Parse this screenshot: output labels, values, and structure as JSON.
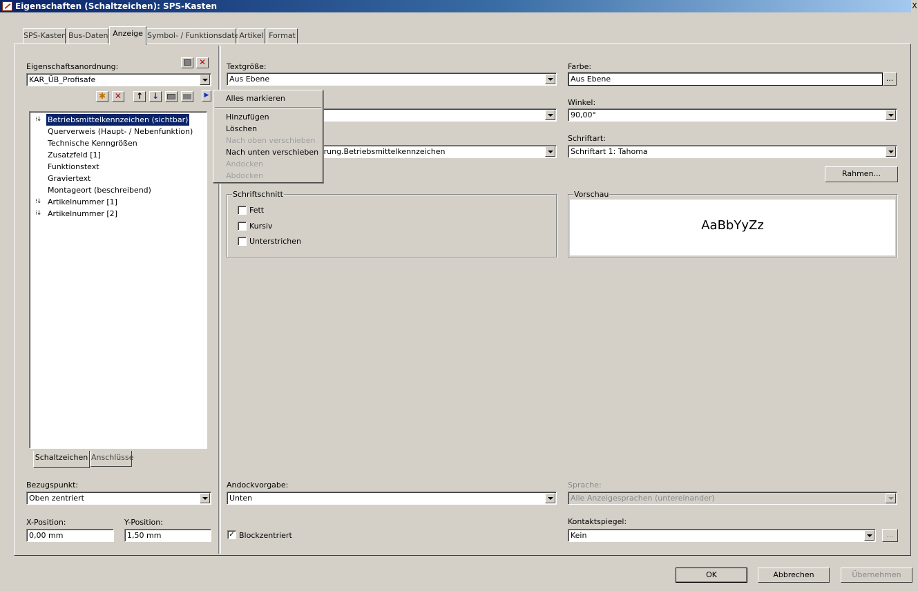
{
  "window": {
    "title": "Eigenschaften (Schaltzeichen): SPS-Kasten",
    "close_glyph": "X"
  },
  "tabs": [
    "SPS-Kasten",
    "Bus-Daten",
    "Anzeige",
    "Symbol- / Funktionsdaten",
    "Artikel",
    "Format"
  ],
  "active_tab": "Anzeige",
  "left": {
    "arrangement_label": "Eigenschaftsanordnung:",
    "arrangement_value": "KAR_ÜB_Profisafe",
    "list_items": [
      {
        "label": "Betriebsmittelkennzeichen (sichtbar)",
        "selected": true,
        "sort_icon": true
      },
      {
        "label": "Querverweis (Haupt- / Nebenfunktion)",
        "selected": false,
        "sort_icon": false
      },
      {
        "label": "Technische Kenngrößen",
        "selected": false,
        "sort_icon": false
      },
      {
        "label": "Zusatzfeld [1]",
        "selected": false,
        "sort_icon": false
      },
      {
        "label": "Funktionstext",
        "selected": false,
        "sort_icon": false
      },
      {
        "label": "Graviertext",
        "selected": false,
        "sort_icon": false
      },
      {
        "label": "Montageort (beschreibend)",
        "selected": false,
        "sort_icon": false
      },
      {
        "label": "Artikelnummer [1]",
        "selected": false,
        "sort_icon": true
      },
      {
        "label": "Artikelnummer [2]",
        "selected": false,
        "sort_icon": true
      }
    ],
    "bottom_tabs": [
      "Schaltzeichen",
      "Anschlüsse"
    ],
    "reference_label": "Bezugspunkt:",
    "reference_value": "Oben zentriert",
    "xpos_label": "X-Position:",
    "xpos_value": "0,00 mm",
    "ypos_label": "Y-Position:",
    "ypos_value": "1,50 mm"
  },
  "context_menu": {
    "items": [
      {
        "label": "Alles markieren",
        "enabled": true
      },
      {
        "label": "Hinzufügen",
        "enabled": true
      },
      {
        "label": "Löschen",
        "enabled": true
      },
      {
        "label": "Nach oben verschieben",
        "enabled": false
      },
      {
        "label": "Nach unten verschieben",
        "enabled": true
      },
      {
        "label": "Andocken",
        "enabled": false
      },
      {
        "label": "Abdocken",
        "enabled": false
      }
    ]
  },
  "right": {
    "textsize_label": "Textgröße:",
    "textsize_value": "Aus Ebene",
    "color_label": "Farbe:",
    "color_value": "Aus Ebene",
    "ellipsis": "...",
    "angle_label": "Winkel:",
    "angle_value": "90,00°",
    "font_label": "Schriftart:",
    "font_value": "Schriftart 1: Tahoma",
    "partial_value": "zierung.Betriebsmittelkennzeichen",
    "frame_button": "Rahmen...",
    "fontstyle_group": "Schriftschnitt",
    "bold": "Fett",
    "italic": "Kursiv",
    "underline": "Unterstrichen",
    "preview_group": "Vorschau",
    "preview_text": "AaBbYyZz",
    "dock_label": "Andockvorgabe:",
    "dock_value": "Unten",
    "language_label": "Sprache:",
    "language_value": "Alle Anzeigesprachen (untereinander)",
    "contact_label": "Kontaktspiegel:",
    "contact_value": "Kein",
    "blockcenter_label": "Blockzentriert",
    "blockcenter_checked": true
  },
  "footer": {
    "ok": "OK",
    "cancel": "Abbrechen",
    "apply": "Übernehmen"
  }
}
